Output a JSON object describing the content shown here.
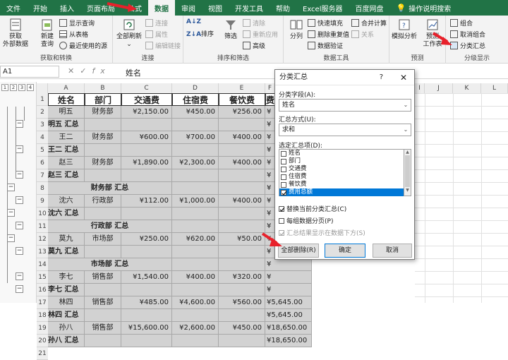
{
  "tabs": [
    "文件",
    "开始",
    "插入",
    "页面布局",
    "公式",
    "数据",
    "审阅",
    "视图",
    "开发工具",
    "帮助",
    "Excel服务器",
    "百度网盘",
    "操作说明搜索"
  ],
  "active_tab": "数据",
  "ribbon": {
    "get_data": {
      "l1": "获取",
      "l2": "外部数据"
    },
    "new_query": {
      "l1": "新建",
      "l2": "查询"
    },
    "show_query": "显示查询",
    "from_table": "从表格",
    "recent_sources": "最近使用的源",
    "group_transform": "获取和转换",
    "refresh_all": {
      "l1": "全部刷新"
    },
    "connections": "连接",
    "properties": "属性",
    "edit_links": "编辑链接",
    "group_connections": "连接",
    "sort": "排序",
    "filter": "筛选",
    "clear": "清除",
    "reapply": "重新应用",
    "advanced": "高级",
    "group_sort": "排序和筛选",
    "split": "分列",
    "flash_fill": "快速填充",
    "remove_dup": "删除重复值",
    "validation": "数据验证",
    "consolidate": "合并计算",
    "relations": "关系",
    "group_tools": "数据工具",
    "whatif": "模拟分析",
    "forecast": {
      "l1": "预测",
      "l2": "工作表"
    },
    "group_forecast": "预测",
    "group_ctl": "组合",
    "ungroup": "取消组合",
    "subtotal": "分类汇总",
    "group_outline": "分级显示"
  },
  "formula_bar": {
    "namebox": "A1",
    "fx": "fx",
    "value": "姓名"
  },
  "outline_levels": [
    "1",
    "2",
    "3",
    "4"
  ],
  "columns": [
    "A",
    "B",
    "C",
    "D",
    "E",
    "F",
    "G",
    "H",
    "I",
    "J",
    "K",
    "L"
  ],
  "rows": [
    "1",
    "2",
    "3",
    "4",
    "5",
    "6",
    "7",
    "8",
    "9",
    "10",
    "11",
    "12",
    "13",
    "14",
    "15",
    "16",
    "17",
    "18",
    "19",
    "20",
    "21"
  ],
  "headers": [
    "姓名",
    "部门",
    "交通费",
    "住宿费",
    "餐饮费",
    "费"
  ],
  "data_rows": [
    [
      "明五",
      "财务部",
      "¥2,150.00",
      "¥450.00",
      "¥256.00",
      "¥"
    ],
    [
      "明五 汇总",
      "",
      "",
      "",
      "",
      "¥"
    ],
    [
      "王二",
      "财务部",
      "¥600.00",
      "¥700.00",
      "¥400.00",
      "¥"
    ],
    [
      "王二 汇总",
      "",
      "",
      "",
      "",
      "¥"
    ],
    [
      "赵三",
      "财务部",
      "¥1,890.00",
      "¥2,300.00",
      "¥400.00",
      "¥"
    ],
    [
      "赵三 汇总",
      "",
      "",
      "",
      "",
      "¥"
    ],
    [
      "财务部 汇总",
      "",
      "",
      "",
      "",
      "¥"
    ],
    [
      "沈六",
      "行政部",
      "¥112.00",
      "¥1,000.00",
      "¥400.00",
      "¥"
    ],
    [
      "沈六 汇总",
      "",
      "",
      "",
      "",
      "¥"
    ],
    [
      "行政部 汇总",
      "",
      "",
      "",
      "",
      "¥"
    ],
    [
      "莫九",
      "市场部",
      "¥250.00",
      "¥620.00",
      "¥50.00",
      "¥"
    ],
    [
      "莫九 汇总",
      "",
      "",
      "",
      "",
      "¥"
    ],
    [
      "市场部 汇总",
      "",
      "",
      "",
      "",
      "¥"
    ],
    [
      "李七",
      "销售部",
      "¥1,540.00",
      "¥400.00",
      "¥320.00",
      "¥"
    ],
    [
      "李七 汇总",
      "",
      "",
      "",
      "",
      "¥"
    ],
    [
      "林四",
      "销售部",
      "¥485.00",
      "¥4,600.00",
      "¥560.00",
      "¥5,645.00"
    ],
    [
      "林四 汇总",
      "",
      "",
      "",
      "",
      "¥5,645.00"
    ],
    [
      "孙八",
      "销售部",
      "¥15,600.00",
      "¥2,600.00",
      "¥450.00",
      "¥18,650.00"
    ],
    [
      "孙八 汇总",
      "",
      "",
      "",
      "",
      "¥18,650.00"
    ]
  ],
  "dialog": {
    "title": "分类汇总",
    "help": "?",
    "close": "✕",
    "field_label": "分类字段(A):",
    "field_value": "姓名",
    "method_label": "汇总方式(U):",
    "method_value": "求和",
    "items_label": "选定汇总项(D):",
    "items": [
      "姓名",
      "部门",
      "交通费",
      "住宿费",
      "餐饮费",
      "费用总额"
    ],
    "checked_item": "费用总额",
    "replace_label": "替换当前分类汇总(C)",
    "pagebreak_label": "每组数据分页(P)",
    "below_label": "汇总结果显示在数据下方(S)",
    "remove_all": "全部删除(R)",
    "ok": "确定",
    "cancel": "取消"
  },
  "colors": {
    "excel_green": "#217346",
    "selection_gray": "#d2d2d2",
    "highlight_blue": "#0078d7",
    "arrow_red": "#e8212b"
  }
}
